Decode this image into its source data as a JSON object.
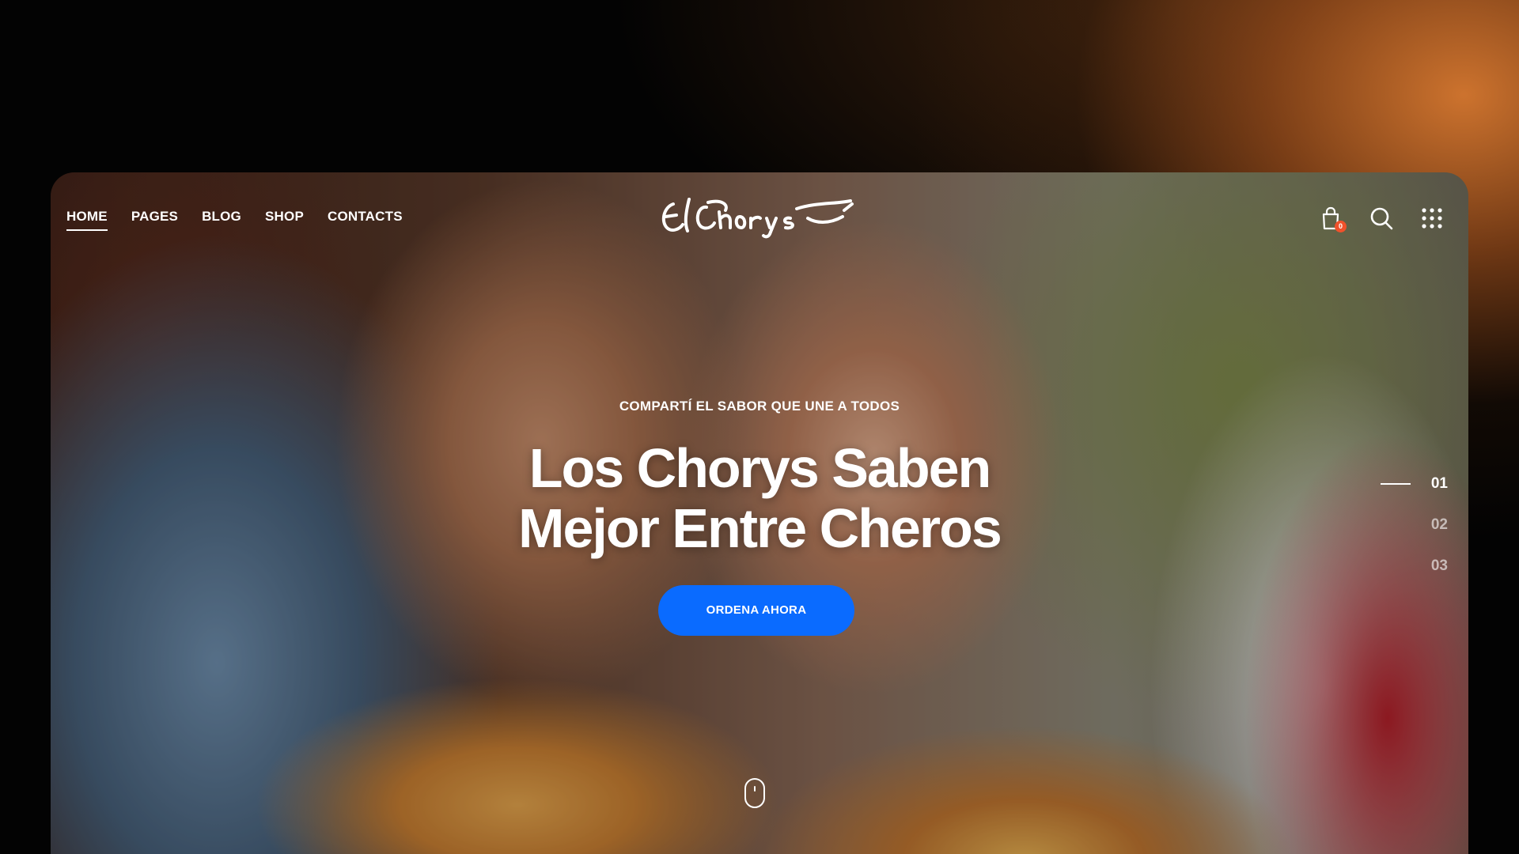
{
  "nav": {
    "items": [
      {
        "label": "HOME",
        "active": true
      },
      {
        "label": "PAGES",
        "active": false
      },
      {
        "label": "BLOG",
        "active": false
      },
      {
        "label": "SHOP",
        "active": false
      },
      {
        "label": "CONTACTS",
        "active": false
      }
    ]
  },
  "logo": {
    "text": "El Chorys"
  },
  "header_icons": {
    "cart": {
      "icon": "shopping-bag-icon",
      "count": "0"
    },
    "search": {
      "icon": "search-icon"
    },
    "menu": {
      "icon": "grid-menu-icon"
    }
  },
  "hero": {
    "eyebrow": "COMPARTÍ EL SABOR QUE UNE A TODOS",
    "headline_line1": "Los Chorys Saben",
    "headline_line2": "Mejor Entre Cheros",
    "cta_label": "ORDENA AHORA",
    "image": "couple holding hot dogs with mustard on a city street"
  },
  "slides": [
    {
      "label": "01",
      "active": true
    },
    {
      "label": "02",
      "active": false
    },
    {
      "label": "03",
      "active": false
    }
  ],
  "colors": {
    "accent": "#0a6bff",
    "badge": "#f0512b",
    "text": "#ffffff"
  }
}
